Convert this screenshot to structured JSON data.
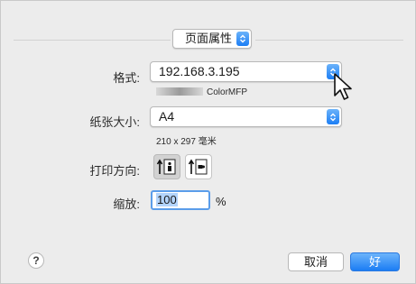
{
  "window": {
    "title": "页面属性"
  },
  "format": {
    "label": "格式:",
    "value": "192.168.3.195",
    "sub": "ColorMFP"
  },
  "paper": {
    "label": "纸张大小:",
    "value": "A4",
    "sub": "210 x 297 毫米"
  },
  "orientation": {
    "label": "打印方向:",
    "options": [
      "portrait-icon",
      "landscape-icon"
    ],
    "selected": "portrait-icon"
  },
  "scale": {
    "label": "缩放:",
    "value": "100",
    "unit": "%"
  },
  "buttons": {
    "help": "?",
    "cancel": "取消",
    "ok": "好"
  },
  "colors": {
    "accent": "#1c7ef5",
    "background": "#ececec"
  }
}
